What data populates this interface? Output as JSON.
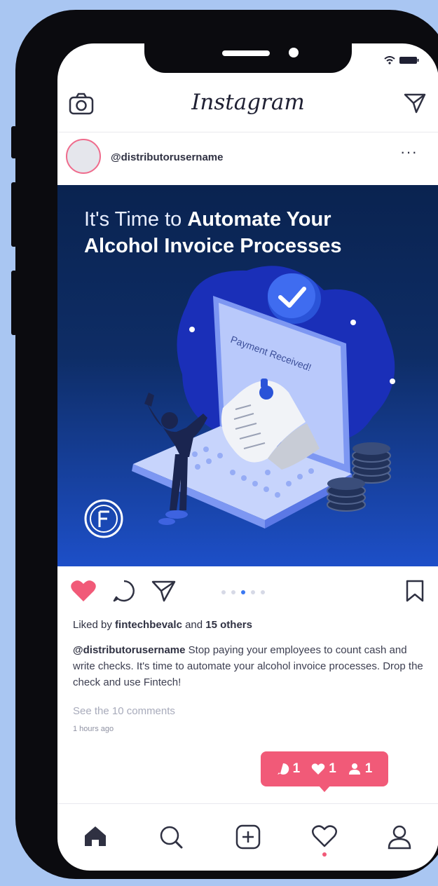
{
  "app": {
    "logo_text": "Instagram"
  },
  "post": {
    "username": "@distributorusername",
    "image": {
      "headline_light": "It's Time to ",
      "headline_bold_1": "Automate Your",
      "headline_bold_2": "Alcohol Invoice Processes",
      "screen_text": "Payment Received!"
    },
    "likes": {
      "prefix": "Liked by",
      "user": "fintechbevalc",
      "and": "and",
      "others": "15 others"
    },
    "caption": {
      "user": "@distributorusername",
      "text": " Stop paying your employees to count cash and write checks. It's time to automate your alcohol invoice processes. Drop the check and use Fintech!"
    },
    "comments_link": "See the 10 comments",
    "timestamp": "1 hours ago",
    "carousel": {
      "count": 5,
      "active_index": 2
    }
  },
  "notification": {
    "comments": "1",
    "likes": "1",
    "follows": "1"
  },
  "colors": {
    "like_red": "#f15a78",
    "accent_blue": "#3a78f2",
    "text_dark": "#2f3142"
  },
  "tabbar": {
    "items": [
      "home-icon",
      "search-icon",
      "add-icon",
      "heart-icon",
      "profile-icon"
    ]
  }
}
